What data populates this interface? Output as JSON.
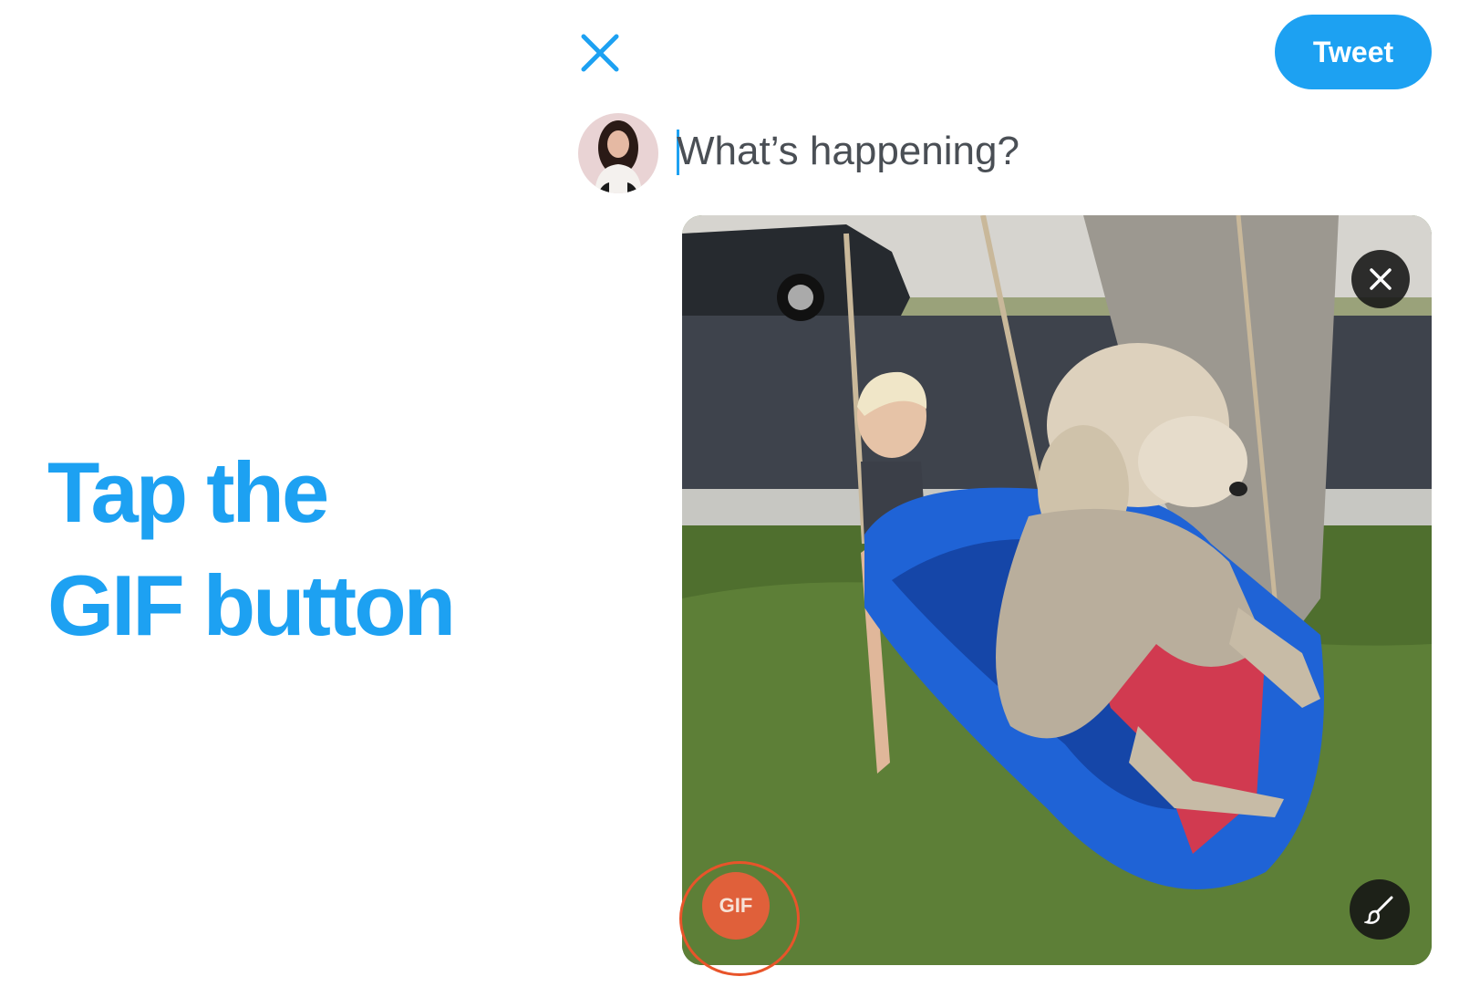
{
  "instruction": {
    "line1": "Tap the",
    "line2": "GIF button"
  },
  "header": {
    "close_icon": "close-icon",
    "tweet_label": "Tweet"
  },
  "composer": {
    "placeholder": "What’s happening?"
  },
  "media": {
    "remove_icon": "close-icon",
    "gif_label": "GIF",
    "edit_icon": "paintbrush-icon"
  },
  "colors": {
    "accent": "#1da1f2",
    "highlight": "#e8542a"
  }
}
